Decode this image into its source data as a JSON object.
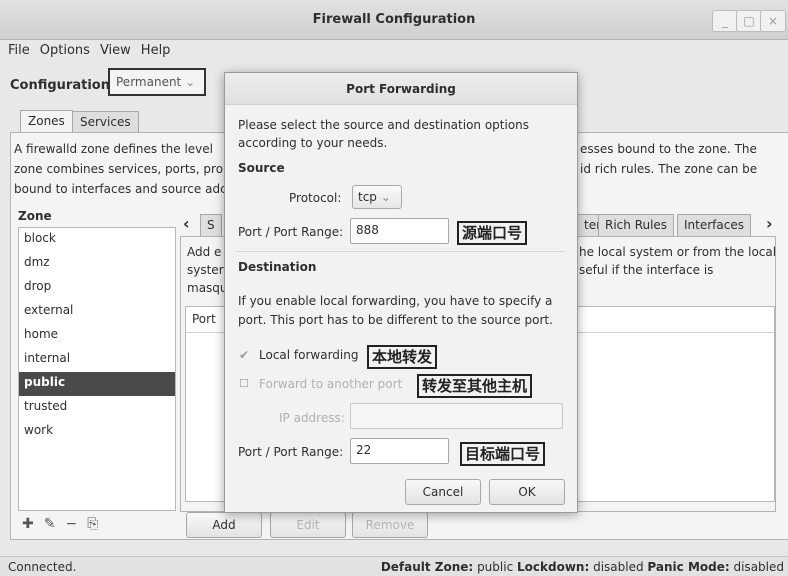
{
  "window": {
    "title": "Firewall Configuration",
    "controls": [
      "_",
      "□",
      "×"
    ]
  },
  "menu": [
    "File",
    "Options",
    "View",
    "Help"
  ],
  "config": {
    "label": "Configuration:",
    "value": "Permanent"
  },
  "tabs": [
    "Zones",
    "Services"
  ],
  "description": {
    "line1_left": "A firewalld zone defines the level",
    "line2_left": "zone combines services, ports, pro",
    "line3_left": "bound to interfaces and source adc",
    "line1_right": "esses bound to the zone. The",
    "line2_right": "id rich rules. The zone can be"
  },
  "zones": {
    "label": "Zone",
    "items": [
      "block",
      "dmz",
      "drop",
      "external",
      "home",
      "internal",
      "public",
      "trusted",
      "work"
    ],
    "selected": "public"
  },
  "right_tabs": {
    "partial": "S",
    "items": [
      "ter",
      "Rich Rules",
      "Interfaces"
    ]
  },
  "inner": {
    "left_lines": [
      "Add e",
      "syster",
      "masqu"
    ],
    "right_line1": "he local system or from the local",
    "right_line2": "seful if the interface is",
    "table_header": "Port"
  },
  "bottom_buttons": [
    "Add",
    "Edit",
    "Remove"
  ],
  "status": {
    "left": "Connected.",
    "default_zone_label": "Default Zone:",
    "default_zone_value": "public",
    "lockdown_label": "Lockdown:",
    "lockdown_value": "disabled",
    "panic_label": "Panic Mode:",
    "panic_value": "disabled"
  },
  "dialog": {
    "title": "Port Forwarding",
    "intro1": "Please select the source and destination options",
    "intro2": "according to your needs.",
    "source_heading": "Source",
    "protocol_label": "Protocol:",
    "protocol_value": "tcp",
    "port_label": "Port / Port Range:",
    "source_port": "888",
    "destination_heading": "Destination",
    "dest_text1": "If you enable local forwarding, you have to specify a",
    "dest_text2": "port. This port has to be different to the source port.",
    "local_forwarding": "Local forwarding",
    "forward_other": "Forward to another port",
    "ip_label": "IP address:",
    "ip_value": "",
    "dest_port": "22",
    "cancel": "Cancel",
    "ok": "OK"
  },
  "annotations": {
    "source_port": "源端口号",
    "local_forwarding": "本地转发",
    "forward_other": "转发至其他主机",
    "dest_port": "目标端口号"
  }
}
